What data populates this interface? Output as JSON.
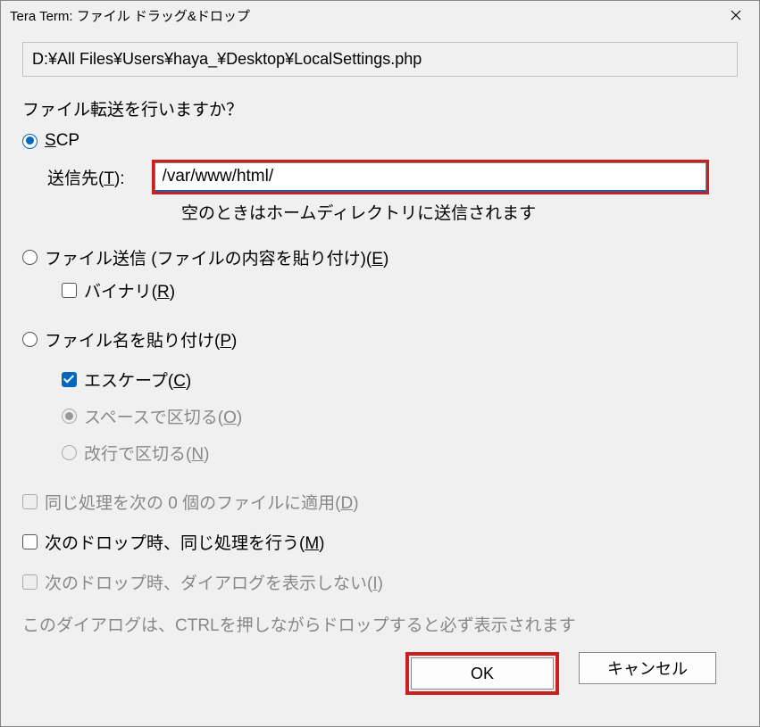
{
  "title": "Tera Term: ファイル ドラッグ&ドロップ",
  "file_path": "D:¥All Files¥Users¥haya_¥Desktop¥LocalSettings.php",
  "prompt": "ファイル転送を行いますか？",
  "scp": {
    "label_pre": "",
    "label_u": "S",
    "label_post": "CP",
    "dest_label_pre": "送信先(",
    "dest_label_u": "T",
    "dest_label_post": "):",
    "dest_value": "/var/www/html/",
    "hint": "空のときはホームディレクトリに送信されます"
  },
  "send_file": {
    "label_pre": "ファイル送信 (ファイルの内容を貼り付け)(",
    "label_u": "E",
    "label_post": ")",
    "binary_pre": "バイナリ(",
    "binary_u": "R",
    "binary_post": ")"
  },
  "paste_name": {
    "label_pre": "ファイル名を貼り付け(",
    "label_u": "P",
    "label_post": ")",
    "escape_pre": "エスケープ(",
    "escape_u": "C",
    "escape_post": ")",
    "space_pre": "スペースで区切る(",
    "space_u": "O",
    "space_post": ")",
    "newline_pre": "改行で区切る(",
    "newline_u": "N",
    "newline_post": ")"
  },
  "apply_same": {
    "pre": "同じ処理を次の 0 個のファイルに適用(",
    "u": "D",
    "post": ")"
  },
  "next_drop_same": {
    "pre": "次のドロップ時、同じ処理を行う(",
    "u": "M",
    "post": ")"
  },
  "next_drop_nodlg": {
    "pre": "次のドロップ時、ダイアログを表示しない(",
    "u": "I",
    "post": ")"
  },
  "note": "このダイアログは、CTRLを押しながらドロップすると必ず表示されます",
  "buttons": {
    "ok": "OK",
    "cancel": "キャンセル"
  }
}
